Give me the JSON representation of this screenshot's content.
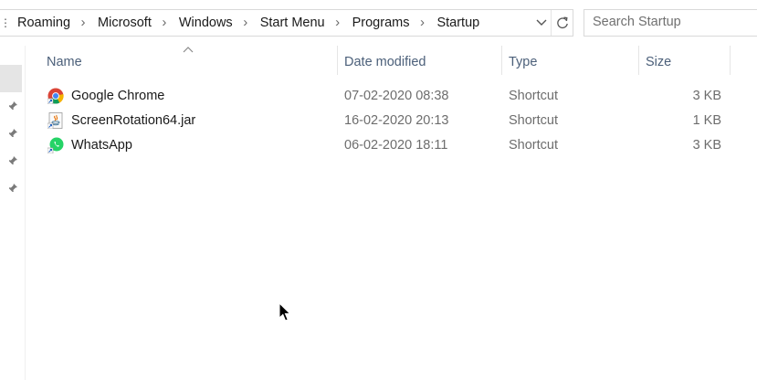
{
  "address_bar": {
    "crumbs": [
      "Roaming",
      "Microsoft",
      "Windows",
      "Start Menu",
      "Programs",
      "Startup"
    ]
  },
  "search": {
    "placeholder": "Search Startup"
  },
  "columns": {
    "name": "Name",
    "date_modified": "Date modified",
    "type": "Type",
    "size": "Size"
  },
  "files": [
    {
      "name": "Google Chrome",
      "date": "07-02-2020 08:38",
      "type": "Shortcut",
      "size": "3 KB",
      "icon": "chrome-icon"
    },
    {
      "name": "ScreenRotation64.jar",
      "date": "16-02-2020 20:13",
      "type": "Shortcut",
      "size": "1 KB",
      "icon": "java-jar-icon"
    },
    {
      "name": "WhatsApp",
      "date": "06-02-2020 18:11",
      "type": "Shortcut",
      "size": "3 KB",
      "icon": "whatsapp-icon"
    }
  ],
  "colors": {
    "header_text": "#4c607a",
    "detail_text": "#6d6d6d",
    "selected_nav": "#e5e5e5"
  }
}
